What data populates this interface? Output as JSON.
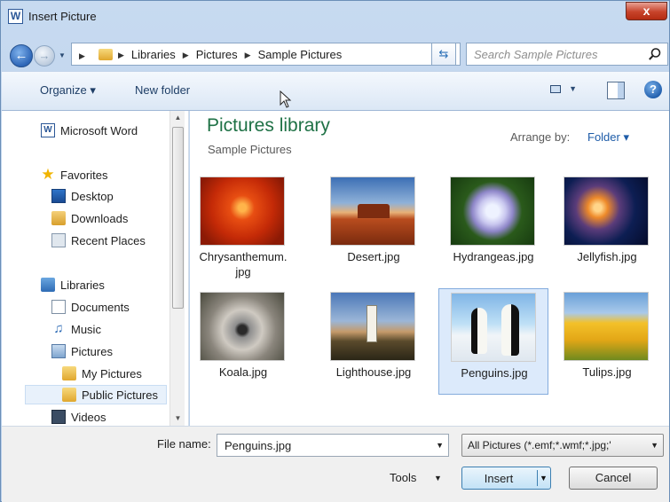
{
  "window": {
    "title": "Insert Picture",
    "app_icon_letter": "W",
    "close_glyph": "x"
  },
  "nav": {
    "breadcrumb": [
      "Libraries",
      "Pictures",
      "Sample Pictures"
    ],
    "search_placeholder": "Search Sample Pictures"
  },
  "commands": {
    "organize": "Organize ▾",
    "new_folder": "New folder"
  },
  "sidebar": {
    "items": [
      {
        "label": "Microsoft Word",
        "icon": "word-icon"
      },
      {
        "label": "Favorites",
        "icon": "star-icon"
      },
      {
        "label": "Desktop",
        "icon": "desktop-icon"
      },
      {
        "label": "Downloads",
        "icon": "downloads-folder-icon"
      },
      {
        "label": "Recent Places",
        "icon": "recent-places-icon"
      },
      {
        "label": "Libraries",
        "icon": "libraries-icon"
      },
      {
        "label": "Documents",
        "icon": "documents-icon"
      },
      {
        "label": "Music",
        "icon": "music-icon"
      },
      {
        "label": "Pictures",
        "icon": "pictures-icon"
      },
      {
        "label": "My Pictures",
        "icon": "folder-icon"
      },
      {
        "label": "Public Pictures",
        "icon": "folder-icon"
      },
      {
        "label": "Videos",
        "icon": "videos-icon"
      }
    ],
    "selected": "Public Pictures"
  },
  "library": {
    "title": "Pictures library",
    "subtitle": "Sample Pictures",
    "arrange_label": "Arrange by:",
    "arrange_value": "Folder ▾"
  },
  "files": [
    {
      "name": "Chrysanthemum.\njpg"
    },
    {
      "name": "Desert.jpg"
    },
    {
      "name": "Hydrangeas.jpg"
    },
    {
      "name": "Jellyfish.jpg"
    },
    {
      "name": "Koala.jpg"
    },
    {
      "name": "Lighthouse.jpg"
    },
    {
      "name": "Penguins.jpg"
    },
    {
      "name": "Tulips.jpg"
    }
  ],
  "selected_file": "Penguins.jpg",
  "footer": {
    "file_name_label": "File name:",
    "file_name_value": "Penguins.jpg",
    "filter": "All Pictures (*.emf;*.wmf;*.jpg;'",
    "tools": "Tools",
    "insert": "Insert",
    "cancel": "Cancel"
  },
  "colors": {
    "library_title": "#1e7145",
    "link_blue": "#1e5ca8",
    "selection": "#dceafb"
  }
}
